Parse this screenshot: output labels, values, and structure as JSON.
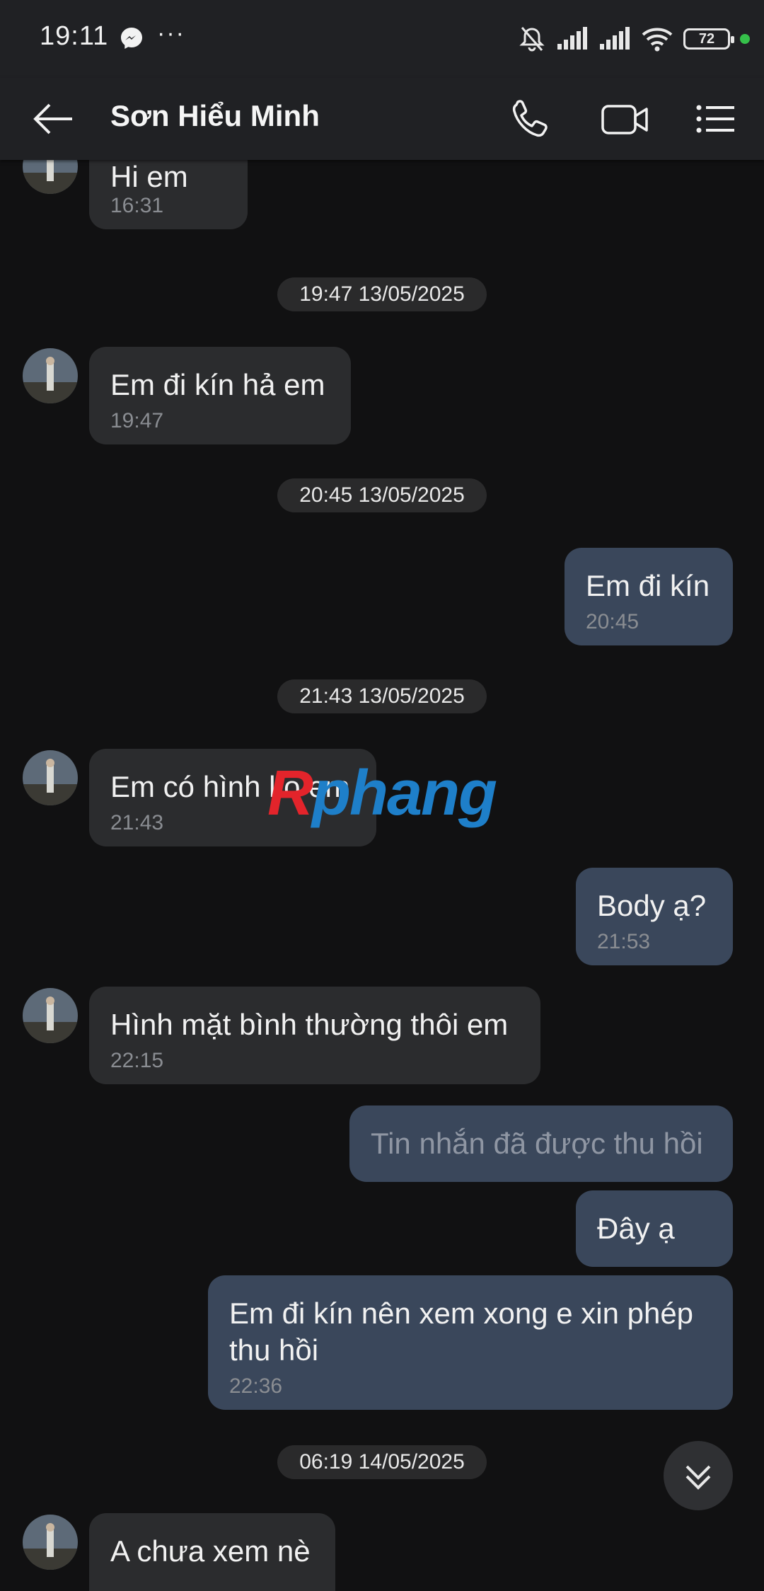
{
  "status_bar": {
    "time": "19:11",
    "dots": "···",
    "battery": "72",
    "icons": [
      "messenger-icon",
      "bell-off-icon",
      "signal-icon",
      "signal-icon",
      "wifi-icon",
      "battery-icon"
    ]
  },
  "header": {
    "title": "Sơn Hiểu Minh",
    "icons": [
      "back-arrow-icon",
      "phone-icon",
      "video-camera-icon",
      "menu-list-icon"
    ]
  },
  "messages": [
    {
      "dir": "in",
      "text": "Hi em",
      "time": "16:31"
    },
    {
      "type": "date",
      "text": "19:47 13/05/2025"
    },
    {
      "dir": "in",
      "text": "Em đi kín hả em",
      "time": "19:47"
    },
    {
      "type": "date",
      "text": "20:45 13/05/2025"
    },
    {
      "dir": "out",
      "text": "Em đi kín",
      "time": "20:45"
    },
    {
      "type": "date",
      "text": "21:43 13/05/2025"
    },
    {
      "dir": "in",
      "text": "Em có hình ko em",
      "time": "21:43"
    },
    {
      "dir": "out",
      "text": "Body ạ?",
      "time": "21:53"
    },
    {
      "dir": "in",
      "text": "Hình mặt bình thường thôi em",
      "time": "22:15"
    },
    {
      "dir": "out",
      "text": "Tin nhắn đã được thu hồi",
      "recalled": true
    },
    {
      "dir": "out",
      "text": "Đây ạ"
    },
    {
      "dir": "out",
      "text": "Em đi kín nên xem xong e xin phép",
      "text2": "thu hồi",
      "time": "22:36"
    },
    {
      "type": "date",
      "text": "06:19 14/05/2025"
    },
    {
      "dir": "in",
      "text": "A chưa xem nè"
    }
  ],
  "watermark": {
    "part1": "R",
    "part2": "phang"
  },
  "scroll_button_icon": "double-chevron-down-icon"
}
